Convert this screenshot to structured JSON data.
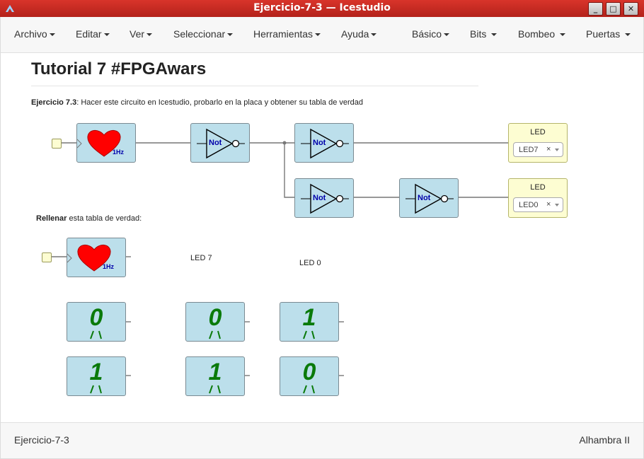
{
  "window": {
    "title": "Ejercicio-7-3 — Icestudio"
  },
  "menu": {
    "left": [
      "Archivo",
      "Editar",
      "Ver",
      "Seleccionar",
      "Herramientas",
      "Ayuda"
    ],
    "right": [
      "Básico",
      "Bits",
      "Bombeo",
      "Puertas"
    ]
  },
  "content": {
    "heading": "Tutorial 7 #FPGAwars",
    "exercise_bold": "Ejercicio 7.3",
    "exercise_text": ": Hacer este circuito en Icestudio, probarlo en la placa y obtener su tabla de verdad",
    "fill_bold": "Rellenar",
    "fill_text": " esta tabla de verdad:",
    "col_led7": "LED 7",
    "col_led0": "LED 0"
  },
  "blocks": {
    "clock_label": "1Hz",
    "not_label": "Not"
  },
  "leds": [
    {
      "title": "LED",
      "value": "LED7",
      "clear": "×"
    },
    {
      "title": "LED",
      "value": "LED0",
      "clear": "×"
    }
  ],
  "table": {
    "rows": [
      [
        "0",
        "0",
        "1"
      ],
      [
        "1",
        "1",
        "0"
      ]
    ]
  },
  "status": {
    "left": "Ejercicio-7-3",
    "right": "Alhambra II"
  }
}
